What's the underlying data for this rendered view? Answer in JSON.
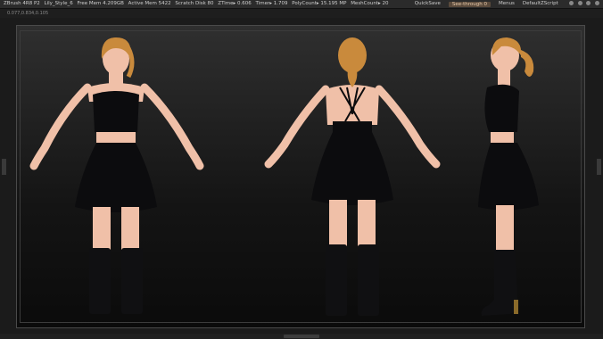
{
  "titlebar": {
    "app": "ZBrush 4R8 P2",
    "document": "Lily_Style_6",
    "free_mem": "Free Mem 4.209GB",
    "active_mem": "Active Mem 5422",
    "scratch": "Scratch Disk 80",
    "ztime": "ZTime▸ 0.606",
    "timer": "Timer▸ 1.709",
    "polycount": "PolyCount▸ 15.195 MP",
    "meshcount": "MeshCount▸ 20",
    "quicksave": "QuickSave",
    "see_through": "See-through  0",
    "menus": "Menus",
    "script": "DefaultZScript"
  },
  "subbar": {
    "coords": "0.077,0.834,0.105"
  },
  "colors": {
    "skin": "#f0c0a8",
    "hair": "#c98a3c",
    "dress": "#0c0c0e",
    "boot": "#101012",
    "heel": "#8a6a2a"
  }
}
